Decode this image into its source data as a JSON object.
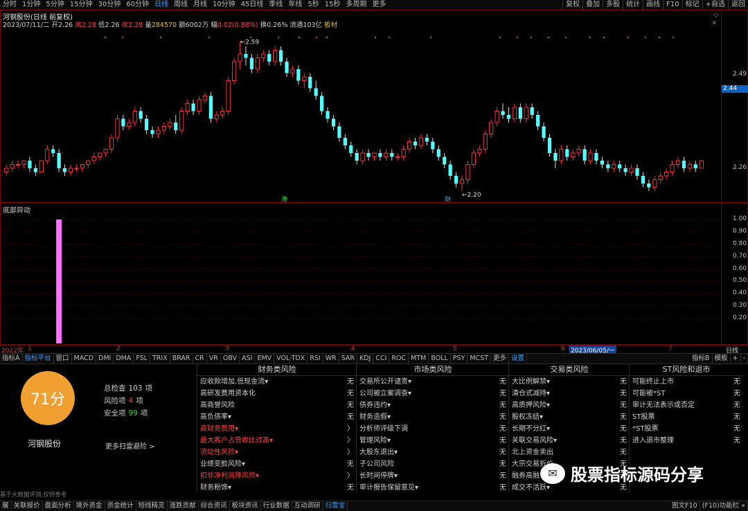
{
  "periods": [
    "分时",
    "1分钟",
    "5分钟",
    "15分钟",
    "30分钟",
    "60分钟",
    "日线",
    "周线",
    "月线",
    "10分钟",
    "45日线",
    "季线",
    "年线",
    "5秒",
    "15秒",
    "多周期",
    "更多"
  ],
  "selected_period": "日线",
  "right_buttons": [
    "复权",
    "叠加",
    "多股",
    "统计",
    "画线",
    "F10",
    "标记",
    "+自选",
    "返回"
  ],
  "stock": {
    "title": "河钢股份(日线 前复权)",
    "date": "2023/07/11/二",
    "open_label": "开",
    "open": "2.26",
    "high_label": "高",
    "high": "2.28",
    "low_label": "低",
    "low": "2.26",
    "close_label": "收",
    "close": "2.28",
    "vol_label": "量",
    "vol": "284570",
    "amt_label": "额",
    "amt": "6002万",
    "chg_label": "幅",
    "chg": "0.02(0.88%)",
    "turn_label": "换",
    "turn": "0.26%",
    "float_label": "流通",
    "float": "103亿",
    "extra": "板材"
  },
  "price_axis": {
    "labels": [
      "2.49",
      "2.44",
      "2.26"
    ],
    "current": "2.44"
  },
  "annotations": {
    "high": "2.59",
    "low": "2.20",
    "mark1": "港",
    "mark2": "财"
  },
  "sub_panel": {
    "title": "底部异动",
    "ticks": [
      "1.00",
      "0.90",
      "0.80",
      "0.70",
      "0.60",
      "0.50",
      "0.40",
      "0.30",
      "0.20"
    ]
  },
  "time_axis": {
    "labels": [
      "2022年",
      "1",
      "2",
      "3",
      "4",
      "5",
      "6",
      "7"
    ],
    "cursor": "2023/06/05/一",
    "right": "日线"
  },
  "indicator_tabs": [
    "指标A",
    "指标平台",
    "窗口",
    "MACD",
    "DMI",
    "DMA",
    "FSL",
    "TRIX",
    "BRAR",
    "CR",
    "VR",
    "OBV",
    "ASI",
    "EMV",
    "VOL-TDX",
    "RSI",
    "WR",
    "SAR",
    "KDJ",
    "CCI",
    "ROC",
    "MTM",
    "BOLL",
    "PSY",
    "MCST",
    "更多",
    "设置"
  ],
  "indicator_right": [
    "指标B",
    "模板",
    "+",
    "-"
  ],
  "score": {
    "value": "71分",
    "name": "河钢股份",
    "more": "更多扫雷避险 >",
    "stats": [
      {
        "label": "总检查",
        "value": "103",
        "unit": "项",
        "color": "#d0d0d0"
      },
      {
        "label": "风险项",
        "value": "4",
        "unit": "项",
        "color": "#ff4040"
      },
      {
        "label": "安全项",
        "value": "99",
        "unit": "项",
        "color": "#40d040"
      }
    ],
    "footnote": "基于大数据评测,仅供参考"
  },
  "risk_columns": [
    {
      "title": "财务类风险",
      "rows": [
        {
          "name": "应收款增加,低现金流▾",
          "val": "无",
          "risk": false
        },
        {
          "name": "高研发费用资本化",
          "val": "无",
          "risk": false
        },
        {
          "name": "高商誉风险",
          "val": "无",
          "risk": false
        },
        {
          "name": "高负债率▾",
          "val": "无",
          "risk": false
        },
        {
          "name": "高财务费用▾",
          "val": "〉",
          "risk": true
        },
        {
          "name": "最大客户占营收比过高▾",
          "val": "〉",
          "risk": true
        },
        {
          "name": "流动性风险▾",
          "val": "〉",
          "risk": true
        },
        {
          "name": "业绩变脸风险▾",
          "val": "无",
          "risk": false
        },
        {
          "name": "扣非净利润降风险▾",
          "val": "〉",
          "risk": true
        },
        {
          "name": "财务粉饰▾",
          "val": "无",
          "risk": false
        }
      ]
    },
    {
      "title": "市场类风险",
      "rows": [
        {
          "name": "交易所公开谴责▾",
          "val": "无",
          "risk": false
        },
        {
          "name": "公司被立案调查▾",
          "val": "无",
          "risk": false
        },
        {
          "name": "债券违约▾",
          "val": "无",
          "risk": false
        },
        {
          "name": "财务造假▾",
          "val": "无",
          "risk": false
        },
        {
          "name": "分析师评级下调",
          "val": "无",
          "risk": false
        },
        {
          "name": "管理风险▾",
          "val": "无",
          "risk": false
        },
        {
          "name": "大股东退出▾",
          "val": "无",
          "risk": false
        },
        {
          "name": "子公司风险",
          "val": "无",
          "risk": false
        },
        {
          "name": "长时间停牌▾",
          "val": "无",
          "risk": false
        },
        {
          "name": "审计报告保留意见▾",
          "val": "无",
          "risk": false
        }
      ]
    },
    {
      "title": "交易类风险",
      "rows": [
        {
          "name": "大比例解禁▾",
          "val": "无",
          "risk": false
        },
        {
          "name": "清仓式减持▾",
          "val": "无",
          "risk": false
        },
        {
          "name": "高质押风险▾",
          "val": "无",
          "risk": false
        },
        {
          "name": "股权冻结▾",
          "val": "无",
          "risk": false
        },
        {
          "name": "长期不分红▾",
          "val": "无",
          "risk": false
        },
        {
          "name": "关联交易风险▾",
          "val": "无",
          "risk": false
        },
        {
          "name": "北上资金卖出",
          "val": "无",
          "risk": false
        },
        {
          "name": "大宗交易折价",
          "val": "无",
          "risk": false
        },
        {
          "name": "融券高融",
          "val": "无",
          "risk": false
        },
        {
          "name": "成交不活跃▾",
          "val": "无",
          "risk": false
        }
      ]
    },
    {
      "title": "ST风险和退市",
      "rows": [
        {
          "name": "可能终止上市",
          "val": "无",
          "risk": false
        },
        {
          "name": "可能被*ST",
          "val": "无",
          "risk": false
        },
        {
          "name": "审计无法表示或否定",
          "val": "无",
          "risk": false
        },
        {
          "name": "ST股票",
          "val": "无",
          "risk": false
        },
        {
          "name": "*ST股票",
          "val": "无",
          "risk": false
        },
        {
          "name": "进入退市整理",
          "val": "无",
          "risk": false
        }
      ]
    }
  ],
  "watermark": "股票指标源码分享",
  "bottom_tabs": [
    "展",
    "关联报价",
    "盘面分析",
    "境外资金",
    "资金统计",
    "短线精灵",
    "涨跌贡献",
    "综合资讯",
    "板块资讯",
    "行业数据",
    "互动调研",
    "扫雷宝"
  ],
  "bottom_right": [
    "图文F10",
    "(F10)功能栏 »"
  ],
  "chart_data": {
    "type": "candlestick",
    "title": "河钢股份(日线 前复权)",
    "ylim": [
      2.18,
      2.62
    ],
    "labeled_ticks": [
      2.26,
      2.49
    ],
    "candles": [
      [
        2.25,
        2.27,
        2.24,
        2.26
      ],
      [
        2.26,
        2.28,
        2.25,
        2.27
      ],
      [
        2.27,
        2.28,
        2.26,
        2.27
      ],
      [
        2.27,
        2.28,
        2.26,
        2.28
      ],
      [
        2.28,
        2.29,
        2.25,
        2.26
      ],
      [
        2.26,
        2.27,
        2.24,
        2.25
      ],
      [
        2.25,
        2.28,
        2.25,
        2.28
      ],
      [
        2.28,
        2.32,
        2.27,
        2.31
      ],
      [
        2.31,
        2.32,
        2.29,
        2.3
      ],
      [
        2.3,
        2.31,
        2.25,
        2.26
      ],
      [
        2.26,
        2.27,
        2.24,
        2.25
      ],
      [
        2.25,
        2.27,
        2.24,
        2.26
      ],
      [
        2.26,
        2.27,
        2.25,
        2.26
      ],
      [
        2.26,
        2.27,
        2.25,
        2.27
      ],
      [
        2.27,
        2.28,
        2.26,
        2.28
      ],
      [
        2.28,
        2.3,
        2.27,
        2.29
      ],
      [
        2.29,
        2.3,
        2.28,
        2.3
      ],
      [
        2.3,
        2.31,
        2.29,
        2.31
      ],
      [
        2.31,
        2.35,
        2.3,
        2.34
      ],
      [
        2.34,
        2.4,
        2.33,
        2.39
      ],
      [
        2.39,
        2.4,
        2.36,
        2.37
      ],
      [
        2.37,
        2.39,
        2.36,
        2.38
      ],
      [
        2.38,
        2.42,
        2.37,
        2.41
      ],
      [
        2.41,
        2.42,
        2.38,
        2.39
      ],
      [
        2.39,
        2.4,
        2.35,
        2.36
      ],
      [
        2.36,
        2.37,
        2.34,
        2.35
      ],
      [
        2.35,
        2.37,
        2.34,
        2.36
      ],
      [
        2.36,
        2.38,
        2.35,
        2.37
      ],
      [
        2.37,
        2.39,
        2.36,
        2.38
      ],
      [
        2.38,
        2.4,
        2.35,
        2.36
      ],
      [
        2.36,
        2.42,
        2.35,
        2.41
      ],
      [
        2.41,
        2.44,
        2.4,
        2.43
      ],
      [
        2.43,
        2.44,
        2.4,
        2.41
      ],
      [
        2.41,
        2.45,
        2.4,
        2.44
      ],
      [
        2.44,
        2.46,
        2.43,
        2.45
      ],
      [
        2.45,
        2.46,
        2.38,
        2.39
      ],
      [
        2.39,
        2.41,
        2.38,
        2.4
      ],
      [
        2.4,
        2.42,
        2.39,
        2.41
      ],
      [
        2.41,
        2.5,
        2.4,
        2.49
      ],
      [
        2.49,
        2.55,
        2.48,
        2.54
      ],
      [
        2.54,
        2.59,
        2.52,
        2.56
      ],
      [
        2.56,
        2.58,
        2.53,
        2.55
      ],
      [
        2.55,
        2.56,
        2.51,
        2.52
      ],
      [
        2.52,
        2.56,
        2.51,
        2.55
      ],
      [
        2.55,
        2.57,
        2.54,
        2.56
      ],
      [
        2.56,
        2.57,
        2.53,
        2.54
      ],
      [
        2.54,
        2.58,
        2.53,
        2.57
      ],
      [
        2.57,
        2.58,
        2.53,
        2.54
      ],
      [
        2.54,
        2.55,
        2.5,
        2.51
      ],
      [
        2.51,
        2.53,
        2.5,
        2.52
      ],
      [
        2.52,
        2.53,
        2.48,
        2.49
      ],
      [
        2.49,
        2.51,
        2.47,
        2.5
      ],
      [
        2.5,
        2.51,
        2.46,
        2.47
      ],
      [
        2.47,
        2.49,
        2.44,
        2.45
      ],
      [
        2.45,
        2.46,
        2.4,
        2.41
      ],
      [
        2.41,
        2.42,
        2.38,
        2.39
      ],
      [
        2.39,
        2.4,
        2.36,
        2.37
      ],
      [
        2.37,
        2.38,
        2.33,
        2.34
      ],
      [
        2.34,
        2.35,
        2.31,
        2.32
      ],
      [
        2.32,
        2.33,
        2.29,
        2.3
      ],
      [
        2.3,
        2.31,
        2.27,
        2.28
      ],
      [
        2.28,
        2.31,
        2.27,
        2.3
      ],
      [
        2.3,
        2.31,
        2.28,
        2.29
      ],
      [
        2.29,
        2.3,
        2.28,
        2.3
      ],
      [
        2.3,
        2.31,
        2.28,
        2.29
      ],
      [
        2.29,
        2.31,
        2.28,
        2.3
      ],
      [
        2.3,
        2.31,
        2.28,
        2.29
      ],
      [
        2.29,
        2.3,
        2.28,
        2.29
      ],
      [
        2.29,
        2.32,
        2.28,
        2.31
      ],
      [
        2.31,
        2.34,
        2.3,
        2.33
      ],
      [
        2.33,
        2.34,
        2.31,
        2.32
      ],
      [
        2.32,
        2.35,
        2.31,
        2.34
      ],
      [
        2.34,
        2.35,
        2.32,
        2.33
      ],
      [
        2.33,
        2.34,
        2.3,
        2.31
      ],
      [
        2.31,
        2.32,
        2.28,
        2.29
      ],
      [
        2.29,
        2.3,
        2.26,
        2.27
      ],
      [
        2.27,
        2.28,
        2.23,
        2.24
      ],
      [
        2.24,
        2.25,
        2.21,
        2.22
      ],
      [
        2.22,
        2.24,
        2.2,
        2.23
      ],
      [
        2.23,
        2.28,
        2.22,
        2.27
      ],
      [
        2.27,
        2.31,
        2.26,
        2.3
      ],
      [
        2.3,
        2.32,
        2.29,
        2.31
      ],
      [
        2.31,
        2.36,
        2.3,
        2.35
      ],
      [
        2.35,
        2.39,
        2.34,
        2.38
      ],
      [
        2.38,
        2.42,
        2.37,
        2.41
      ],
      [
        2.41,
        2.43,
        2.39,
        2.4
      ],
      [
        2.4,
        2.42,
        2.38,
        2.39
      ],
      [
        2.39,
        2.43,
        2.38,
        2.42
      ],
      [
        2.42,
        2.43,
        2.38,
        2.39
      ],
      [
        2.39,
        2.43,
        2.38,
        2.42
      ],
      [
        2.42,
        2.43,
        2.39,
        2.4
      ],
      [
        2.4,
        2.41,
        2.36,
        2.37
      ],
      [
        2.37,
        2.38,
        2.33,
        2.34
      ],
      [
        2.34,
        2.35,
        2.29,
        2.3
      ],
      [
        2.3,
        2.31,
        2.26,
        2.28
      ],
      [
        2.28,
        2.32,
        2.27,
        2.31
      ],
      [
        2.31,
        2.32,
        2.28,
        2.29
      ],
      [
        2.29,
        2.31,
        2.28,
        2.3
      ],
      [
        2.3,
        2.32,
        2.29,
        2.31
      ],
      [
        2.31,
        2.32,
        2.27,
        2.28
      ],
      [
        2.28,
        2.31,
        2.27,
        2.3
      ],
      [
        2.3,
        2.31,
        2.27,
        2.28
      ],
      [
        2.28,
        2.29,
        2.26,
        2.27
      ],
      [
        2.27,
        2.28,
        2.25,
        2.26
      ],
      [
        2.26,
        2.28,
        2.25,
        2.27
      ],
      [
        2.27,
        2.28,
        2.25,
        2.26
      ],
      [
        2.26,
        2.27,
        2.24,
        2.25
      ],
      [
        2.25,
        2.27,
        2.24,
        2.26
      ],
      [
        2.26,
        2.27,
        2.23,
        2.24
      ],
      [
        2.24,
        2.25,
        2.21,
        2.22
      ],
      [
        2.22,
        2.23,
        2.2,
        2.21
      ],
      [
        2.21,
        2.24,
        2.2,
        2.23
      ],
      [
        2.23,
        2.25,
        2.22,
        2.24
      ],
      [
        2.24,
        2.26,
        2.23,
        2.25
      ],
      [
        2.25,
        2.28,
        2.24,
        2.27
      ],
      [
        2.27,
        2.29,
        2.26,
        2.28
      ],
      [
        2.28,
        2.29,
        2.25,
        2.26
      ],
      [
        2.26,
        2.28,
        2.25,
        2.27
      ],
      [
        2.27,
        2.28,
        2.25,
        2.26
      ],
      [
        2.26,
        2.28,
        2.26,
        2.28
      ]
    ],
    "sub_series": {
      "name": "底部异动",
      "signal_index": 9,
      "value": 1.0,
      "ylim": [
        0,
        1.05
      ]
    }
  }
}
